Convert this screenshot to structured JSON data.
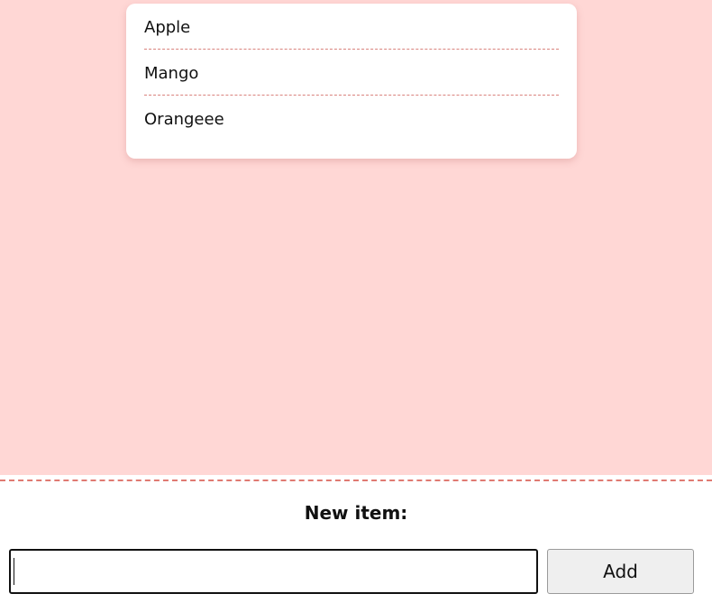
{
  "list": {
    "items": [
      {
        "label": "Apple"
      },
      {
        "label": "Mango"
      },
      {
        "label": "Orangeee"
      }
    ]
  },
  "form": {
    "label": "New item:",
    "input_value": "",
    "input_placeholder": "",
    "add_label": "Add"
  },
  "colors": {
    "list_background": "#ffd7d5",
    "card_background": "#ffffff",
    "divider": "#e07a72",
    "button_background": "#efefef"
  }
}
